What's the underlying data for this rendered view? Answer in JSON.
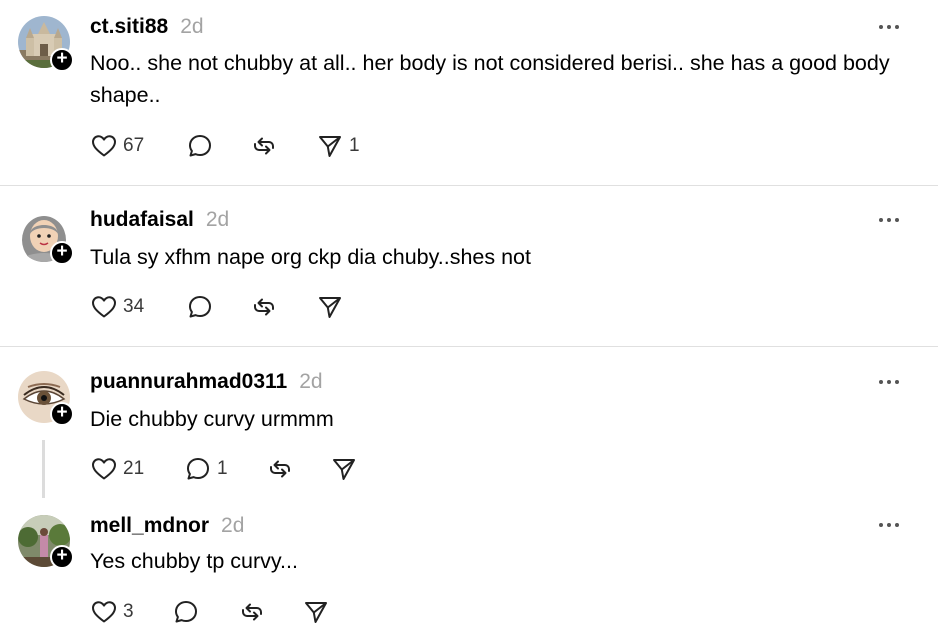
{
  "posts": [
    {
      "username": "ct.siti88",
      "time": "2d",
      "avatar": "castle-photo",
      "text": "Noo.. she not chubby at all.. her body is not considered berisi.. she has a good body shape..",
      "likes": "67",
      "replies": "",
      "reposts": "",
      "shares": "1"
    },
    {
      "username": "hudafaisal",
      "time": "2d",
      "avatar": "hijab-cartoon",
      "text": "Tula sy xfhm nape org ckp dia chuby..shes not",
      "likes": "34",
      "replies": "",
      "reposts": "",
      "shares": ""
    },
    {
      "username": "puannurahmad0311",
      "time": "2d",
      "avatar": "eye-closeup",
      "text": "Die chubby curvy urmmm",
      "likes": "21",
      "replies": "1",
      "reposts": "",
      "shares": ""
    },
    {
      "username": "mell_mdnor",
      "time": "2d",
      "avatar": "person-outdoor-photo",
      "text": "Yes chubby tp curvy...",
      "likes": "3",
      "replies": "",
      "reposts": "",
      "shares": ""
    }
  ],
  "colors": {
    "text": "#000000",
    "muted": "#a3a3a3",
    "divider": "#e0e0e0"
  }
}
